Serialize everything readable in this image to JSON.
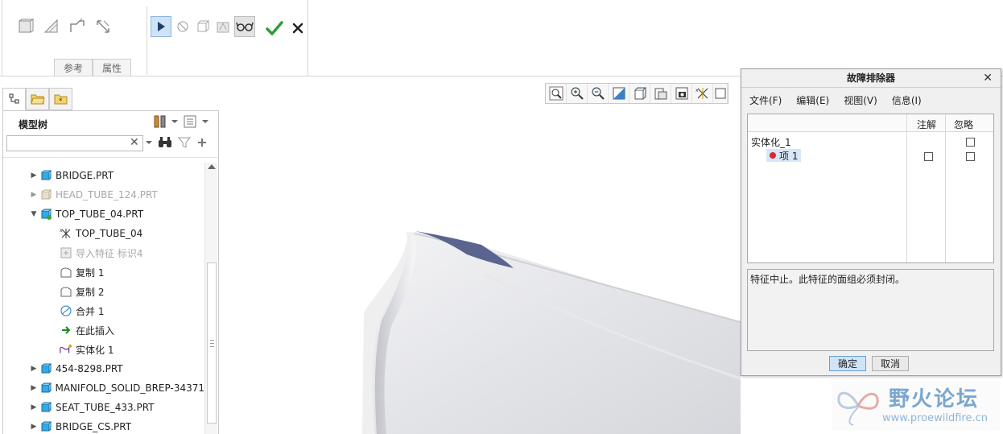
{
  "dashboard": {
    "tabs": [
      "参考",
      "属性"
    ]
  },
  "left_panel": {
    "title": "模型树",
    "search": {
      "value": "",
      "placeholder": ""
    },
    "tree": [
      {
        "label": "BRIDGE.PRT",
        "expanded": false,
        "dim": false,
        "indent": 0
      },
      {
        "label": "HEAD_TUBE_124.PRT",
        "expanded": false,
        "dim": true,
        "indent": 0
      },
      {
        "label": "TOP_TUBE_04.PRT",
        "expanded": true,
        "dim": false,
        "indent": 0
      },
      {
        "label": "TOP_TUBE_04",
        "dim": false,
        "indent": 1
      },
      {
        "label": "导入特征 标识4",
        "dim": true,
        "indent": 1
      },
      {
        "label": "复制 1",
        "dim": false,
        "indent": 1
      },
      {
        "label": "复制 2",
        "dim": false,
        "indent": 1
      },
      {
        "label": "合并 1",
        "dim": false,
        "indent": 1
      },
      {
        "label": "在此插入",
        "dim": false,
        "indent": 1
      },
      {
        "label": "实体化 1",
        "dim": false,
        "indent": 1
      },
      {
        "label": "454-8298.PRT",
        "expanded": false,
        "dim": false,
        "indent": 0
      },
      {
        "label": "MANIFOLD_SOLID_BREP-34371",
        "expanded": false,
        "dim": false,
        "indent": 0
      },
      {
        "label": "SEAT_TUBE_433.PRT",
        "expanded": false,
        "dim": false,
        "indent": 0
      },
      {
        "label": "BRIDGE_CS.PRT",
        "expanded": false,
        "dim": false,
        "indent": 0
      }
    ]
  },
  "dialog": {
    "title": "故障排除器",
    "menu": [
      "文件(F)",
      "编辑(E)",
      "视图(V)",
      "信息(I)"
    ],
    "columns": {
      "note": "注解",
      "ignore": "忽略"
    },
    "parent_item": "实体化_1",
    "child_item": "项 1",
    "message": "特征中止。此特征的面组必须封闭。",
    "ok": "确定",
    "cancel": "取消"
  },
  "watermark": {
    "name": "野火论坛",
    "url": "www.proewildfire.cn"
  },
  "colors": {
    "accent": "#2a7fd4",
    "selection": "#d5e7f8",
    "error": "#e0252a",
    "ok_check": "#2e9d34",
    "surface_edge": "#5a648e"
  }
}
